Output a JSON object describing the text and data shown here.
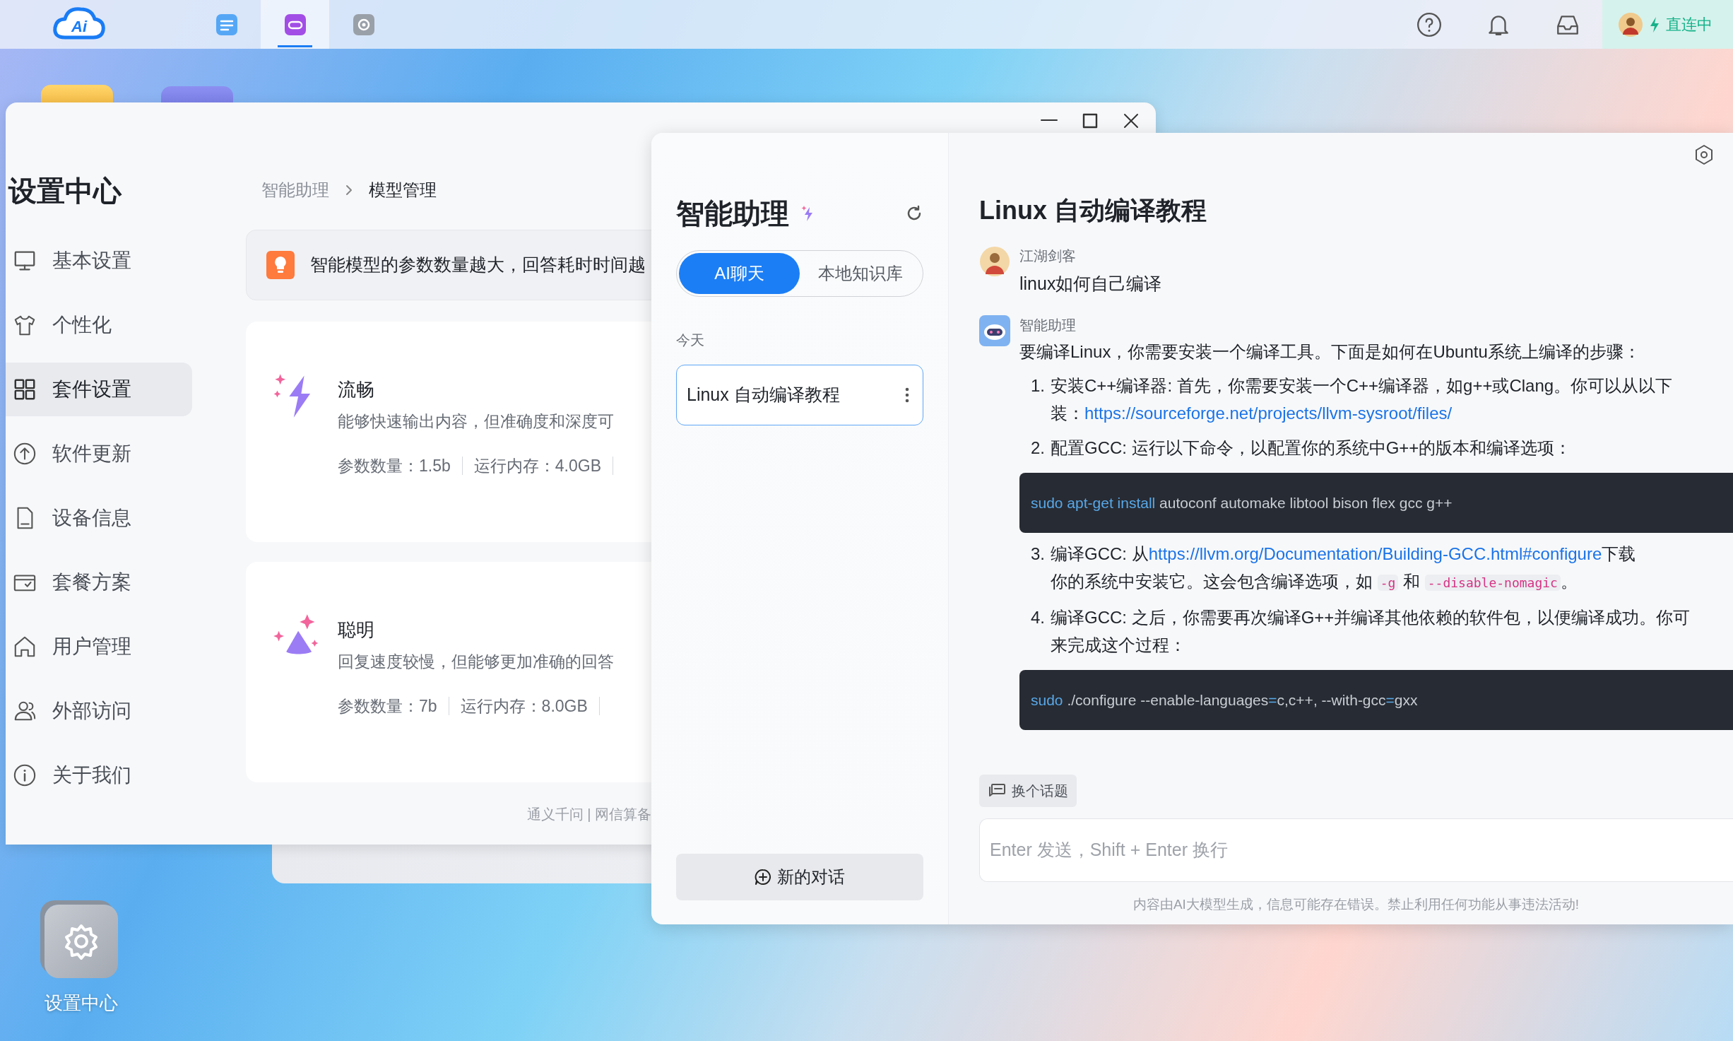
{
  "taskbar": {
    "logo_text": "Ai",
    "apps": [
      {
        "kind": "notes",
        "selected": false
      },
      {
        "kind": "link",
        "selected": true
      },
      {
        "kind": "settings",
        "selected": false
      }
    ],
    "status": {
      "label": "直连中"
    }
  },
  "settings_window": {
    "title": "设置中心",
    "nav": [
      {
        "kind": "monitor",
        "label": "基本设置",
        "selected": false
      },
      {
        "kind": "shirt",
        "label": "个性化",
        "selected": false
      },
      {
        "kind": "grid",
        "label": "套件设置",
        "selected": true
      },
      {
        "kind": "upload",
        "label": "软件更新",
        "selected": false
      },
      {
        "kind": "document",
        "label": "设备信息",
        "selected": false
      },
      {
        "kind": "wallet",
        "label": "套餐方案",
        "selected": false
      },
      {
        "kind": "home",
        "label": "用户管理",
        "selected": false
      },
      {
        "kind": "users",
        "label": "外部访问",
        "selected": false
      },
      {
        "kind": "info",
        "label": "关于我们",
        "selected": false
      }
    ],
    "breadcrumb": [
      "智能助理",
      "模型管理"
    ],
    "tip": "智能模型的参数数量越大，回答耗时时间越",
    "models": [
      {
        "kind": "bolt",
        "name": "流畅",
        "description": "能够快速输出内容，但准确度和深度可",
        "stats": [
          "参数数量：1.5b",
          "运行内存：4.0GB"
        ]
      },
      {
        "kind": "cone",
        "name": "聪明",
        "description": "回复速度较慢，但能够更加准确的回答",
        "stats": [
          "参数数量：7b",
          "运行内存：8.0GB"
        ]
      }
    ],
    "footer": "通义千问 | 网信算备"
  },
  "desktop_icons": [
    {
      "label": "设置中心"
    }
  ],
  "chat_window": {
    "sidebar": {
      "title": "智能助理",
      "modes": [
        {
          "label": "AI聊天",
          "selected": true
        },
        {
          "label": "本地知识库",
          "selected": false
        }
      ],
      "group": "今天",
      "conversations": [
        {
          "title": "Linux 自动编译教程",
          "selected": true
        }
      ],
      "new_button": "新的对话"
    },
    "conversation": {
      "title": "Linux 自动编译教程",
      "messages": [
        {
          "kind": "user",
          "author": "江湖剑客",
          "text": "linux如何自己编译"
        },
        {
          "kind": "assistant",
          "author": "智能助理",
          "blocks": [
            {
              "kind": "paragraph",
              "text": "要编译Linux，你需要安装一个编译工具。下面是如何在Ubuntu系统上编译的步骤："
            },
            {
              "kind": "item",
              "number": "1.",
              "lines": [
                [
                  {
                    "kind": "text",
                    "text": "安装C++编译器: 首先，你需要安装一个C++编译器，如g++或Clang。你可以从以下"
                  }
                ],
                [
                  {
                    "kind": "text",
                    "text": "装："
                  },
                  {
                    "kind": "link",
                    "text": "https://sourceforge.net/projects/llvm-sysroot/files/"
                  }
                ]
              ]
            },
            {
              "kind": "item",
              "number": "2.",
              "lines": [
                [
                  {
                    "kind": "text",
                    "text": "配置GCC: 运行以下命令，以配置你的系统中G++的版本和编译选项："
                  }
                ]
              ]
            },
            {
              "kind": "code",
              "segments": [
                {
                  "kind": "keyword",
                  "text": "sudo apt-get install"
                },
                {
                  "kind": "text",
                  "text": " autoconf automake libtool bison flex gcc g++"
                }
              ]
            },
            {
              "kind": "item",
              "number": "3.",
              "lines": [
                [
                  {
                    "kind": "text",
                    "text": "编译GCC: 从"
                  },
                  {
                    "kind": "link",
                    "text": "https://llvm.org/Documentation/Building-GCC.html#configure"
                  },
                  {
                    "kind": "text",
                    "text": "下载"
                  }
                ],
                [
                  {
                    "kind": "text",
                    "text": "你的系统中安装它。这会包含编译选项，如 "
                  },
                  {
                    "kind": "code",
                    "text": "-g"
                  },
                  {
                    "kind": "text",
                    "text": " 和 "
                  },
                  {
                    "kind": "code",
                    "text": "--disable-nomagic"
                  },
                  {
                    "kind": "text",
                    "text": "。"
                  }
                ]
              ]
            },
            {
              "kind": "item",
              "number": "4.",
              "lines": [
                [
                  {
                    "kind": "text",
                    "text": "编译GCC: 之后，你需要再次编译G++并编译其他依赖的软件包，以便编译成功。你可"
                  }
                ],
                [
                  {
                    "kind": "text",
                    "text": "来完成这个过程："
                  }
                ]
              ]
            },
            {
              "kind": "code",
              "segments": [
                {
                  "kind": "keyword",
                  "text": "sudo"
                },
                {
                  "kind": "text",
                  "text": " ./configure --enable-languages"
                },
                {
                  "kind": "keyword",
                  "text": "="
                },
                {
                  "kind": "text",
                  "text": "c,c++, --with-gcc"
                },
                {
                  "kind": "keyword",
                  "text": "="
                },
                {
                  "kind": "text",
                  "text": "gxx"
                }
              ]
            }
          ]
        }
      ]
    },
    "topic_button": "换个话题",
    "input": {
      "placeholder": "Enter 发送，Shift + Enter 换行"
    },
    "disclaimer": "内容由AI大模型生成，信息可能存在错误。禁止利用任何功能从事违法活动!"
  }
}
